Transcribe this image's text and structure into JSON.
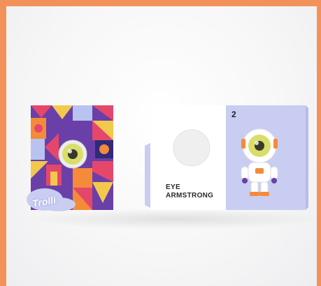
{
  "image": {
    "frame_color": "#F2925A",
    "background_color": "#F7F7F8"
  },
  "left_card": {
    "brand_text": "Trolli",
    "colors": [
      "#E5476B",
      "#6A3FA8",
      "#F2C94C",
      "#F48A3A",
      "#B9C3F0",
      "#2F2A7A"
    ]
  },
  "right_card": {
    "number": "2",
    "title_line1": "EYE",
    "title_line2": "ARMSTRONG",
    "card_color": "#C9CDF2",
    "inner_color": "#FFFFFF",
    "eyeball_color": "#D9DE6A"
  }
}
